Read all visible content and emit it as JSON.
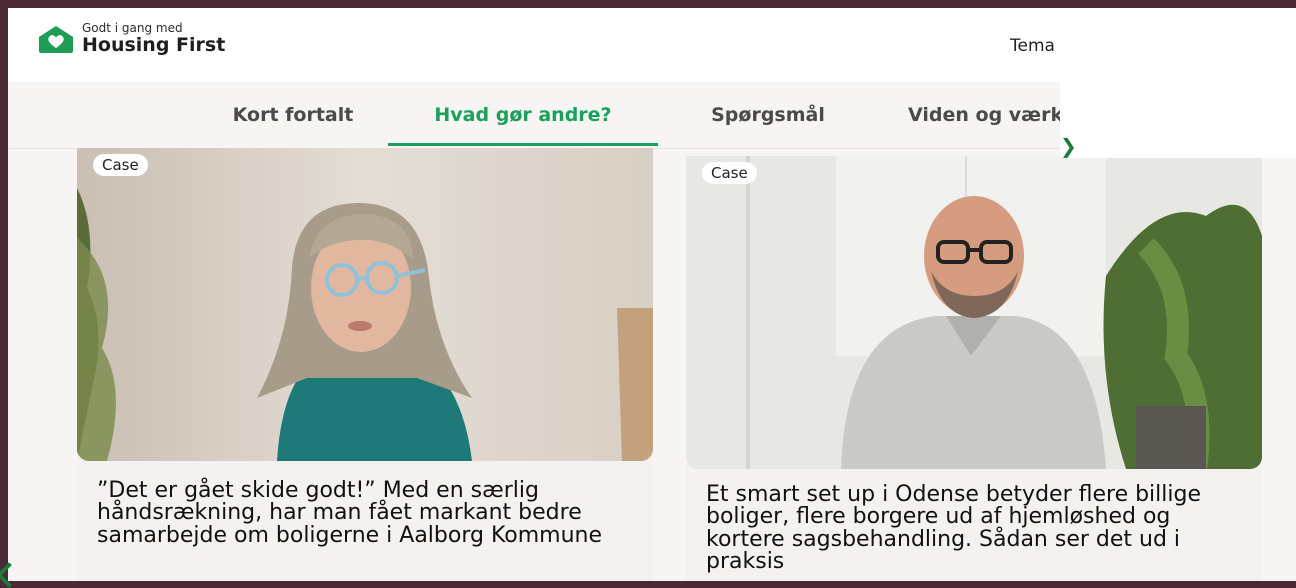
{
  "header": {
    "logo_small": "Godt i gang med",
    "logo_big": "Housing First",
    "nav_item": "Tema"
  },
  "subnav": {
    "tabs": [
      {
        "label": "Kort fortalt",
        "active": false
      },
      {
        "label": "Hvad gør andre?",
        "active": true
      },
      {
        "label": "Spørgsmål",
        "active": false
      },
      {
        "label": "Viden og værk",
        "active": false
      }
    ]
  },
  "cards": [
    {
      "badge": "Case",
      "title": "”Det er gået skide godt!” Med en særlig håndsrækning, har man fået markant bedre samarbejde om boligerne i Aalborg Kommune"
    },
    {
      "badge": "Case",
      "title": "Et smart set up i Odense betyder flere billige boliger, flere borgere ud af hjemløshed og kortere sagsbehandling. Sådan ser det ud i praksis"
    }
  ],
  "colors": {
    "accent": "#1aa05a",
    "frame": "#4a2a35",
    "logo_green": "#1d9d55"
  },
  "icons": [
    "house-heart-logo-icon",
    "chevron-icon"
  ]
}
